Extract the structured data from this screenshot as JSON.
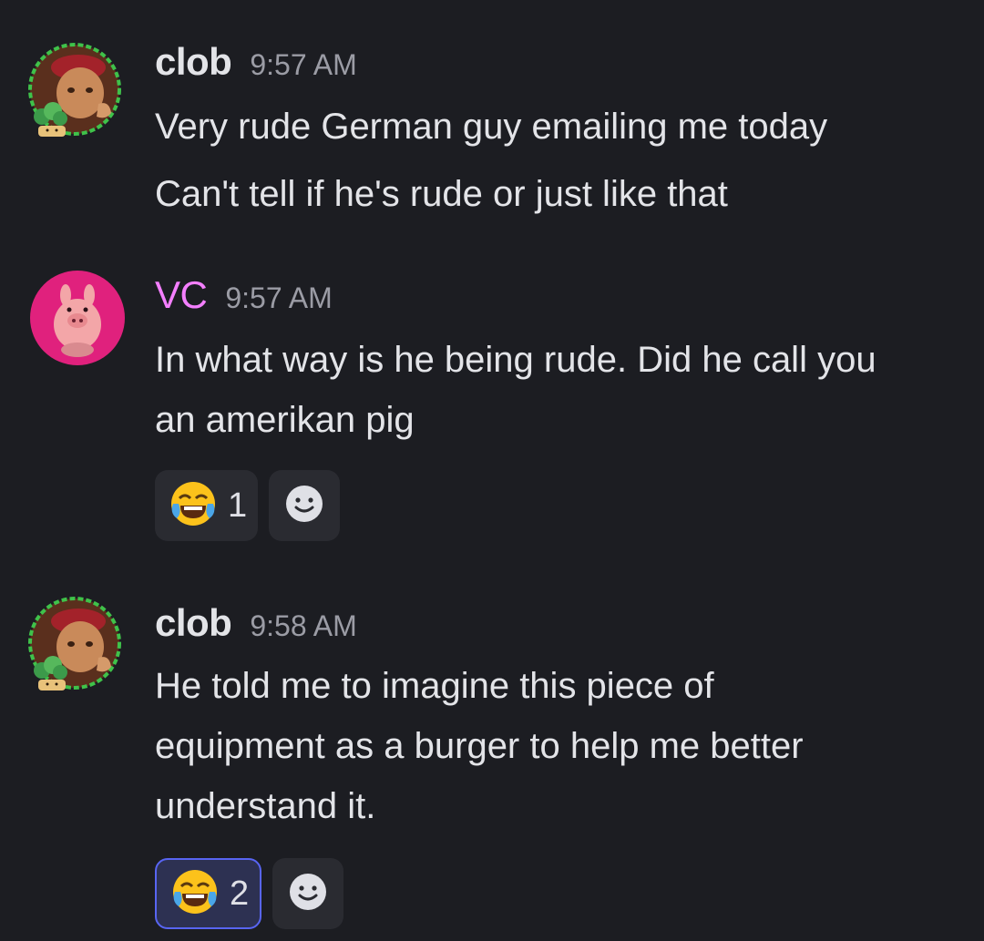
{
  "messages": [
    {
      "author": "clob",
      "author_color": "#e3e4e8",
      "time": "9:57 AM",
      "avatar": "bonsai-portrait-avatar",
      "lines": [
        "Very rude German guy emailing me today",
        "Can't tell if he's rude or just like that"
      ]
    },
    {
      "author": "VC",
      "author_color": "#f47fff",
      "time": "9:57 AM",
      "avatar": "pig-avatar",
      "lines": [
        "In what way is he being rude. Did he call you",
        "an amerikan pig"
      ],
      "reaction": {
        "emoji": "joy-emoji",
        "count": "1",
        "active": false
      }
    },
    {
      "author": "clob",
      "author_color": "#e3e4e8",
      "time": "9:58 AM",
      "avatar": "bonsai-portrait-avatar",
      "lines": [
        "He told me to imagine this piece of",
        "equipment as a burger to help me better",
        "understand it."
      ],
      "reaction": {
        "emoji": "joy-emoji",
        "count": "2",
        "active": true
      }
    }
  ],
  "colors": {
    "background": "#1c1d22",
    "reaction_bg": "#2a2b31",
    "reaction_active_border": "#5865f2",
    "timestamp": "#9b9ca5"
  }
}
